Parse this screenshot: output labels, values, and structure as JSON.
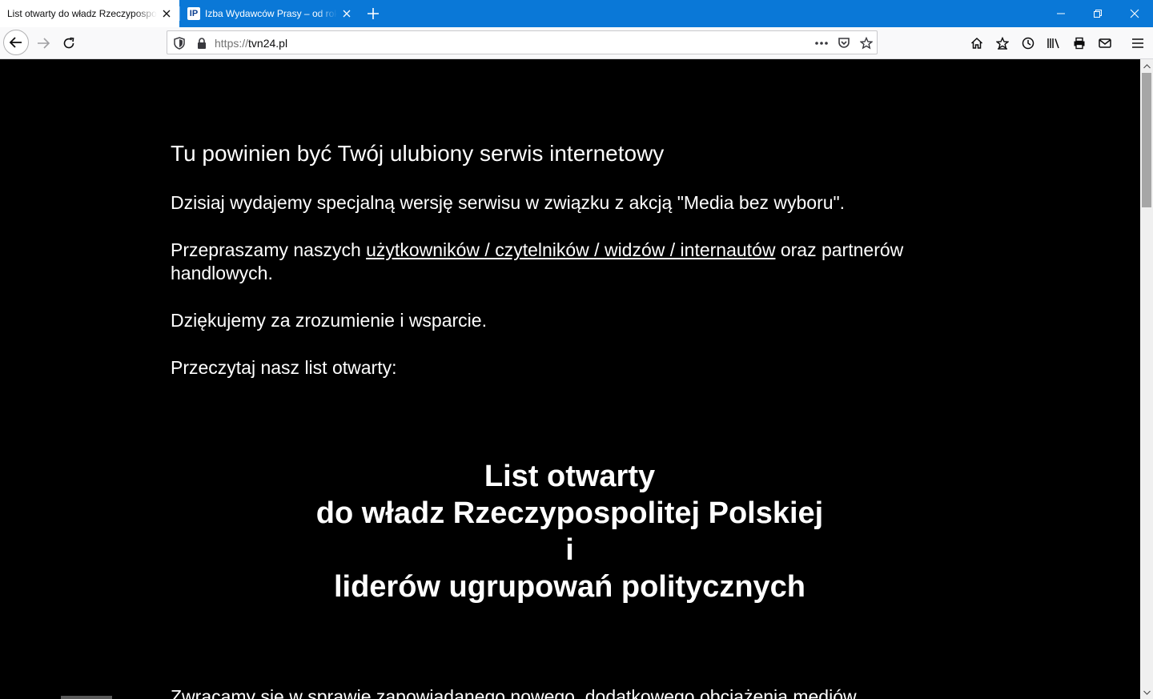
{
  "tabs": [
    {
      "title": "List otwarty do władz Rzeczypospolitej",
      "active": true
    },
    {
      "title": "Izba Wydawców Prasy – od roku",
      "active": false,
      "favicon_text": "IP"
    }
  ],
  "window": {
    "minimize": "minimize-icon",
    "restore": "restore-icon",
    "close": "close-icon"
  },
  "urlbar": {
    "scheme": "https://",
    "host": "tvn24.pl"
  },
  "toolbar_icons": [
    "home-icon",
    "bookmark-star-icon",
    "history-icon",
    "library-icon",
    "print-icon",
    "email-icon",
    "menu-icon"
  ],
  "content": {
    "headline": "Tu powinien być Twój ulubiony serwis internetowy",
    "p1": "Dzisiaj wydajemy specjalną wersję serwisu w związku z akcją \"Media bez wyboru\".",
    "p2_before": "Przepraszamy naszych ",
    "p2_link": "użytkowników / czytelników / widzów / internautów",
    "p2_after": " oraz partnerów handlowych.",
    "p3": "Dziękujemy za zrozumienie i wsparcie.",
    "p4": "Przeczytaj nasz list otwarty:",
    "letter_title": [
      "List otwarty",
      "do władz Rzeczypospolitej Polskiej",
      "i",
      "liderów ugrupowań politycznych"
    ],
    "cut_line": "Zwracamy się w sprawie zapowiadanego nowego, dodatkowego obciążenia mediów"
  },
  "colors": {
    "tabstrip": "#0a78d7",
    "page_bg": "#000000",
    "text": "#ffffff"
  }
}
